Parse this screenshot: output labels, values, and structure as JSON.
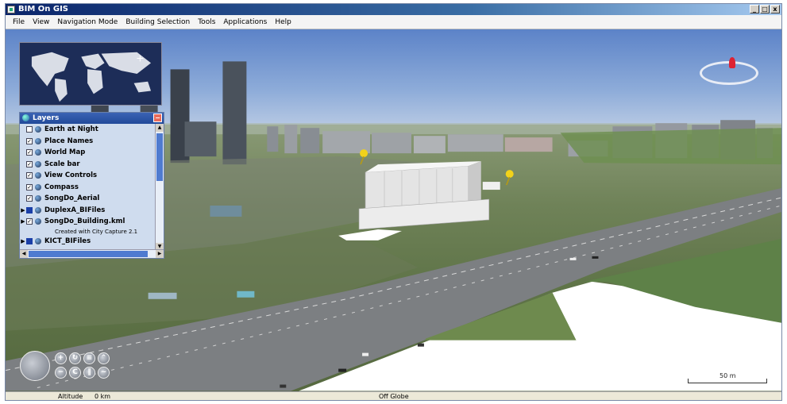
{
  "window": {
    "title": "BIM On GIS",
    "controls": [
      "_",
      "□",
      "x"
    ]
  },
  "menu": [
    "File",
    "View",
    "Navigation Mode",
    "Building Selection",
    "Tools",
    "Applications",
    "Help"
  ],
  "layers_panel": {
    "title": "Layers",
    "close_glyph": "−",
    "items": [
      {
        "label": "Earth at Night",
        "checked": false
      },
      {
        "label": "Place Names",
        "checked": true
      },
      {
        "label": "World Map",
        "checked": true
      },
      {
        "label": "Scale bar",
        "checked": true
      },
      {
        "label": "View Controls",
        "checked": true
      },
      {
        "label": "Compass",
        "checked": true
      },
      {
        "label": "SongDo_Aerial",
        "checked": true
      },
      {
        "label": "DuplexA_BIFiles",
        "checked": true,
        "expandable": true
      },
      {
        "label": "SongDo_Building.kml",
        "checked": true,
        "expandable": true,
        "sublabel": "Created with City Capture 2.1"
      },
      {
        "label": "KICT_BIFiles",
        "checked": true,
        "expandable": true
      }
    ]
  },
  "nav_controls": {
    "zoom_in": "+",
    "zoom_out": "−"
  },
  "scale_bar": {
    "label": "50 m"
  },
  "status_bar": {
    "altitude_label": "Altitude",
    "altitude_value": "0 km",
    "globe_status": "Off Globe"
  },
  "colors": {
    "title_bar": "#0a246a",
    "layers_header": "#3b63b4",
    "sky": "#8eacd9",
    "compass_needle": "#dd2233"
  }
}
